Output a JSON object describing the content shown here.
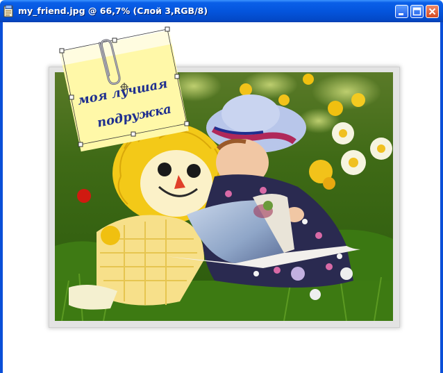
{
  "window": {
    "title": "my_friend.jpg @ 66,7% (Слой 3,RGB/8)",
    "controls": [
      "minimize",
      "maximize",
      "close"
    ]
  },
  "note": {
    "line1": "моя лучшая",
    "line2": "подружка",
    "color": "#fff8a8"
  },
  "icons": {
    "app": "photoshop-document-icon",
    "paperclip": "paperclip-icon"
  },
  "colors": {
    "titlebar": "#0455dd",
    "photo_frame": "#e3e3e3",
    "note_text": "#1f2f8f"
  }
}
